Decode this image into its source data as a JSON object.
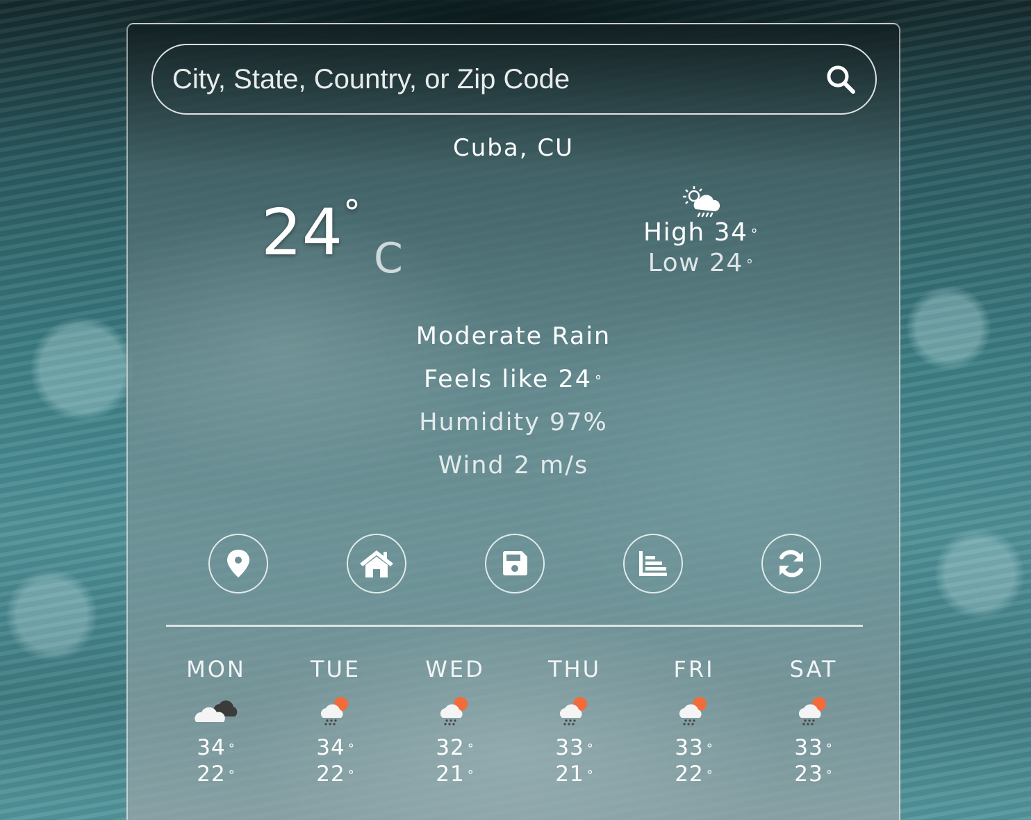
{
  "search": {
    "placeholder": "City, State, Country, or Zip Code",
    "icon": "search-icon"
  },
  "location": "Cuba, CU",
  "current": {
    "temp": "24",
    "degree": "°",
    "unit": "C",
    "icon": "sun-cloud-rain-icon",
    "high_label": "High 34",
    "low_label": "Low 24",
    "deg": "°"
  },
  "details": {
    "condition": "Moderate Rain",
    "feels_like": "Feels like 24",
    "humidity": "Humidity 97%",
    "wind": "Wind 2 m/s"
  },
  "actions": [
    {
      "name": "location-pin-icon"
    },
    {
      "name": "home-icon"
    },
    {
      "name": "save-icon"
    },
    {
      "name": "chart-icon"
    },
    {
      "name": "refresh-icon"
    }
  ],
  "forecast": [
    {
      "day": "MON",
      "high": "34",
      "low": "22",
      "icon": "cloudy-icon"
    },
    {
      "day": "TUE",
      "high": "34",
      "low": "22",
      "icon": "sun-rain-icon"
    },
    {
      "day": "WED",
      "high": "32",
      "low": "21",
      "icon": "sun-rain-icon"
    },
    {
      "day": "THU",
      "high": "33",
      "low": "21",
      "icon": "sun-rain-icon"
    },
    {
      "day": "FRI",
      "high": "33",
      "low": "22",
      "icon": "sun-rain-icon"
    },
    {
      "day": "SAT",
      "high": "33",
      "low": "23",
      "icon": "sun-rain-icon"
    }
  ],
  "colors": {
    "accent_sun": "#f26b3a",
    "cloud_dark": "#3a3a3a",
    "cloud_light": "#f2f2f2"
  }
}
